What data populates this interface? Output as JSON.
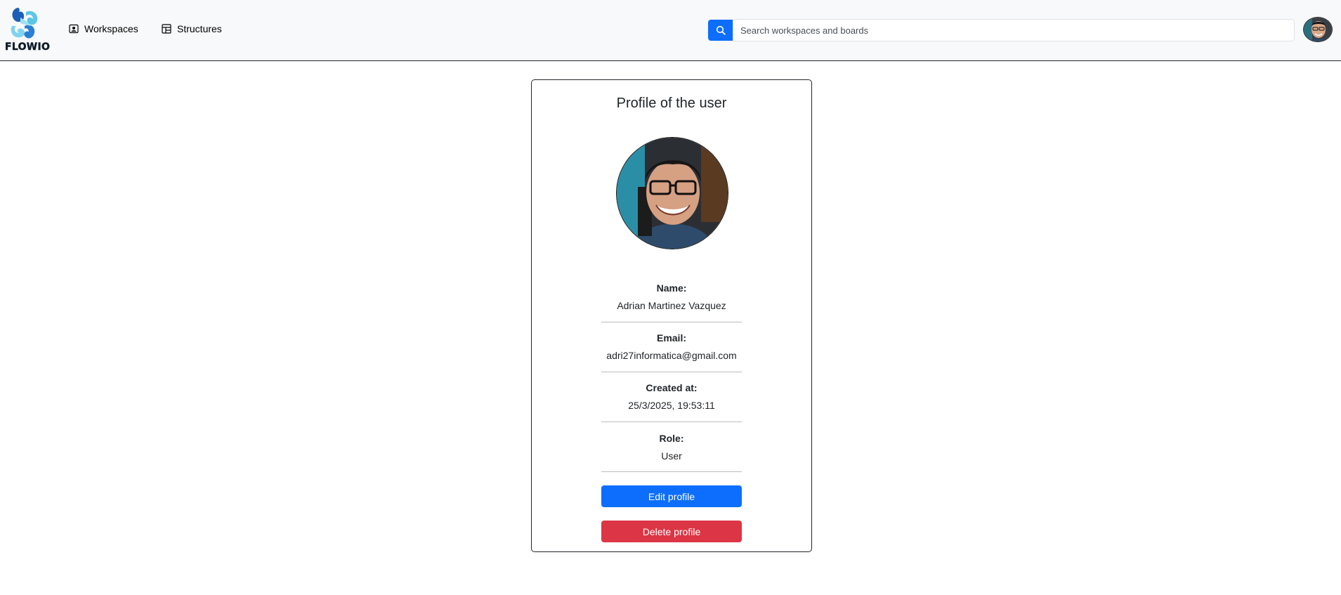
{
  "colors": {
    "primary": "#0d6efd",
    "danger": "#dc3545",
    "navbar_bg": "#f8f9fa"
  },
  "navbar": {
    "logo_text": "FLOWIO",
    "nav_items": [
      {
        "label": "Workspaces",
        "icon": "person-badge-icon"
      },
      {
        "label": "Structures",
        "icon": "layout-icon"
      }
    ],
    "search": {
      "icon": "search-icon",
      "placeholder": "Search workspaces and boards",
      "value": ""
    },
    "avatar_icon": "user-avatar"
  },
  "profile": {
    "title": "Profile of the user",
    "photo": "profile-photo",
    "fields": [
      {
        "label": "Name:",
        "value": "Adrian Martinez Vazquez"
      },
      {
        "label": "Email:",
        "value": "adri27informatica@gmail.com"
      },
      {
        "label": "Created at:",
        "value": "25/3/2025, 19:53:11"
      },
      {
        "label": "Role:",
        "value": "User"
      }
    ],
    "edit_button": "Edit profile",
    "delete_button": "Delete profile"
  }
}
